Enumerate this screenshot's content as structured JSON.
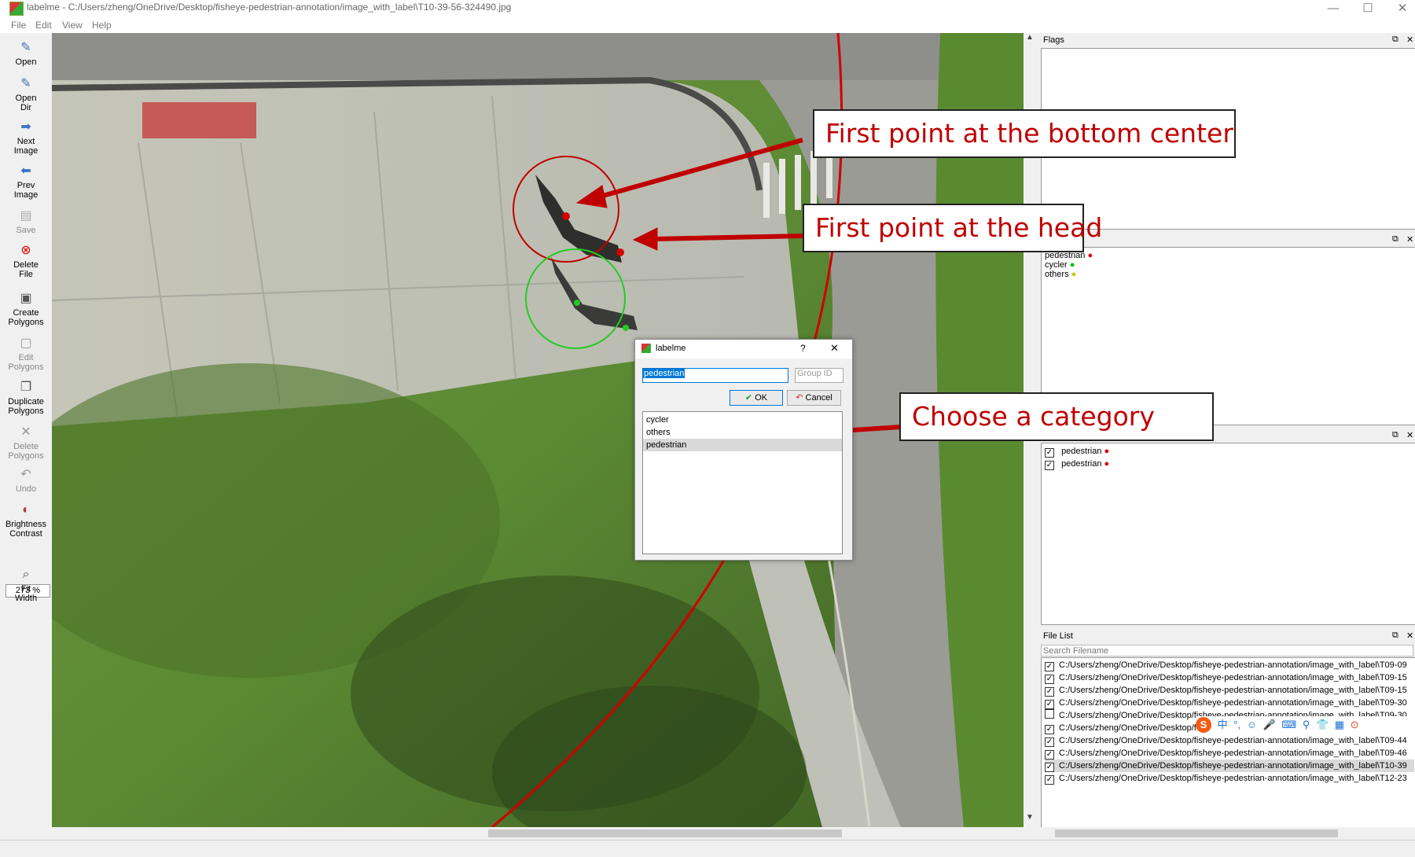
{
  "window": {
    "title": "labelme - C:/Users/zheng/OneDrive/Desktop/fisheye-pedestrian-annotation/image_with_label\\T10-39-56-324490.jpg",
    "controls": [
      "—",
      "☐",
      "✕"
    ]
  },
  "menu": [
    "File",
    "Edit",
    "View",
    "Help"
  ],
  "toolbar": {
    "items": [
      {
        "label": "Open",
        "icon": "folder-icon",
        "glyph": "✎"
      },
      {
        "label": "Open Dir",
        "icon": "folder-open-icon",
        "glyph": "✎"
      },
      {
        "label": "Next Image",
        "icon": "arrow-right-icon",
        "glyph": "➡"
      },
      {
        "label": "Prev Image",
        "icon": "arrow-left-icon",
        "glyph": "⬅"
      },
      {
        "label": "Save",
        "icon": "save-icon",
        "glyph": "▤"
      },
      {
        "label": "Delete File",
        "icon": "delete-file-icon",
        "glyph": "⊗"
      },
      {
        "label": "Create Polygons",
        "icon": "create-polygon-icon",
        "glyph": "▣"
      },
      {
        "label": "Edit Polygons",
        "icon": "edit-polygon-icon",
        "glyph": "▢"
      },
      {
        "label": "Duplicate Polygons",
        "icon": "duplicate-polygon-icon",
        "glyph": "❐"
      },
      {
        "label": "Delete Polygons",
        "icon": "delete-polygon-icon",
        "glyph": "✕"
      },
      {
        "label": "Undo",
        "icon": "undo-icon",
        "glyph": "↶"
      },
      {
        "label": "Brightness Contrast",
        "icon": "brightness-icon",
        "glyph": "◐"
      }
    ],
    "zoom": "273 %",
    "fit_width": {
      "label": "Fit Width",
      "icon": "zoom-fit-icon",
      "glyph": "⌕"
    }
  },
  "callouts": {
    "bottom_center": "First point at the bottom center",
    "head": "First point at the head",
    "category": "Choose a category"
  },
  "dialog": {
    "title": "labelme",
    "help": "?",
    "close": "✕",
    "label_value": "pedestrian",
    "group_placeholder": "Group ID",
    "ok": "OK",
    "cancel": "Cancel",
    "list": [
      "cycler",
      "others",
      "pedestrian"
    ],
    "selected_index": 2
  },
  "docks": {
    "flags_title": "Flags",
    "label_list": [
      {
        "name": "pedestrian",
        "color": "#e00000"
      },
      {
        "name": "cycler",
        "color": "#00c000"
      },
      {
        "name": "others",
        "color": "#c8c800"
      }
    ],
    "polygon_labels": [
      {
        "name": "pedestrian",
        "checked": true,
        "color": "#e00000"
      },
      {
        "name": "pedestrian",
        "checked": true,
        "color": "#e00000"
      }
    ],
    "file_list_title": "File List",
    "search_placeholder": "Search Filename",
    "files": [
      {
        "path": "C:/Users/zheng/OneDrive/Desktop/fisheye-pedestrian-annotation/image_with_label\\T09-09",
        "checked": true
      },
      {
        "path": "C:/Users/zheng/OneDrive/Desktop/fisheye-pedestrian-annotation/image_with_label\\T09-15",
        "checked": true
      },
      {
        "path": "C:/Users/zheng/OneDrive/Desktop/fisheye-pedestrian-annotation/image_with_label\\T09-15",
        "checked": true
      },
      {
        "path": "C:/Users/zheng/OneDrive/Desktop/fisheye-pedestrian-annotation/image_with_label\\T09-30",
        "checked": true
      },
      {
        "path": "C:/Users/zheng/OneDrive/Desktop/fisheye-pedestrian-annotation/image_with_label\\T09-30",
        "checked": false
      },
      {
        "path": "C:/Users/zheng/OneDrive/Desktop/fisheye-pedestrian-annotation/image_with_label\\T09-34",
        "checked": true
      },
      {
        "path": "C:/Users/zheng/OneDrive/Desktop/fisheye-pedestrian-annotation/image_with_label\\T09-44",
        "checked": true
      },
      {
        "path": "C:/Users/zheng/OneDrive/Desktop/fisheye-pedestrian-annotation/image_with_label\\T09-46",
        "checked": true
      },
      {
        "path": "C:/Users/zheng/OneDrive/Desktop/fisheye-pedestrian-annotation/image_with_label\\T10-39",
        "checked": true,
        "selected": true
      },
      {
        "path": "C:/Users/zheng/OneDrive/Desktop/fisheye-pedestrian-annotation/image_with_label\\T12-23",
        "checked": true
      }
    ]
  },
  "ime_toolbar": {
    "brand_glyph": "S",
    "glyphs": [
      "中",
      "°,",
      "☺",
      "🎤",
      "⌨",
      "⚲",
      "👕",
      "▦",
      "⊙"
    ]
  },
  "colors": {
    "annotation_red": "#c00000",
    "annotation_green": "#22cc22",
    "callout_text": "#c00000"
  }
}
